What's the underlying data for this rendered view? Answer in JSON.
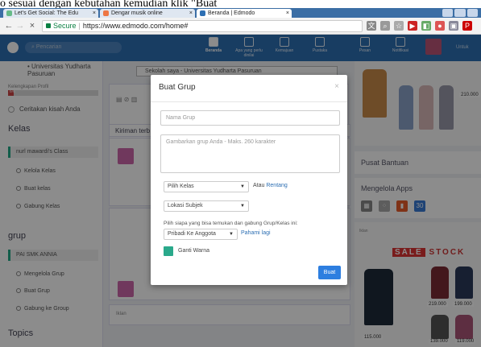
{
  "caption_text": "o sesuai dengan kebutahan kemudian klik \"Buat",
  "browser": {
    "tabs": [
      {
        "label": "Let's Get Social: The Edu",
        "active": false
      },
      {
        "label": "Dengar musik online",
        "active": false
      },
      {
        "label": "Beranda | Edmodo",
        "active": true
      }
    ],
    "secure_label": "Secure",
    "url": "https://www.edmodo.com/home#"
  },
  "header": {
    "search_placeholder": "Pencarian",
    "nav": [
      {
        "label": "Beranda",
        "active": true
      },
      {
        "label": "Apa yang perlu dinilai",
        "active": false
      },
      {
        "label": "Kemajuan",
        "active": false
      },
      {
        "label": "Pustaka",
        "active": false
      },
      {
        "label": "Pesan",
        "active": false
      },
      {
        "label": "Notifikasi",
        "active": false
      }
    ],
    "user_label": "Untuk"
  },
  "sidebar": {
    "school": "• Universitas Yudharta Pasuruan",
    "profile_progress_label": "Kelengkapan Profil",
    "profile_progress": 0.06,
    "profile_progress_text": "6%",
    "story_link": "Ceritakan kisah Anda",
    "kelas_title": "Kelas",
    "kelas_items": [
      "nurl mawardi's Class",
      "Kelola Kelas",
      "Buat kelas",
      "Gabung Kelas"
    ],
    "grup_title": "grup",
    "grup_items": [
      "PAI SMK ANNIA",
      "Mengelola Grup",
      "Buat Grup",
      "Gabung ke Group"
    ],
    "topics_title": "Topics"
  },
  "main": {
    "school_select": "Sekolah saya - Universitas Yudharta Pasuruan",
    "kiriman_label": "Kiriman terb",
    "bottom_label": "Iklan"
  },
  "right": {
    "price_1": "210.000",
    "pusat_bantuan": "Pusat Bantuan",
    "mengelola_apps": "Mengelola Apps",
    "app_number": "30",
    "ad_label": "Iklan",
    "sale": "SALE",
    "stock": "STOCK",
    "price_2": "219.000",
    "price_3": "199.000",
    "price_4": "115.000",
    "price_5": "139.000",
    "price_6": "119.000"
  },
  "modal": {
    "title": "Buat Grup",
    "close_glyph": "×",
    "name_placeholder": "Nama Grup",
    "desc_placeholder": "Gambarkan grup Anda - Maks. 260 karakter",
    "kelas_select": "Pilih Kelas",
    "atau": "Atau",
    "rentang": "Rentang",
    "lokasi_select": "Lokasi Subjek",
    "pilih_label": "Pilih siapa yang bisa temukan dan gabung Grup/Kelas ini:",
    "privacy_select": "Pribadi Ke Anggota",
    "pahami": "Pahami lagi",
    "ganti_warna": "Ganti Warna",
    "swatch_color": "#2aa98b",
    "submit": "Buat"
  }
}
